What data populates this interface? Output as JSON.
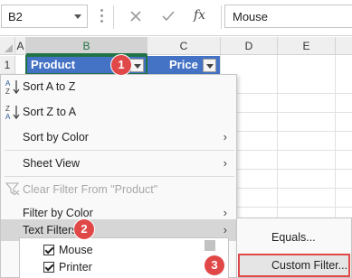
{
  "formula_bar": {
    "name_box": "B2",
    "fx": "fx",
    "content": "Mouse"
  },
  "columns": [
    "A",
    "B",
    "C",
    "D",
    "E"
  ],
  "rows": [
    "1"
  ],
  "header_row": {
    "product": "Product",
    "price": "Price"
  },
  "menu": {
    "sort_az": "Sort A to Z",
    "sort_za": "Sort Z to A",
    "sort_by_color": "Sort by Color",
    "sheet_view": "Sheet View",
    "clear_filter": "Clear Filter From \"Product\"",
    "filter_by_color": "Filter by Color",
    "text_filters": "Text Filters",
    "items": [
      {
        "label": "Mouse",
        "checked": true
      },
      {
        "label": "Printer",
        "checked": true
      }
    ]
  },
  "submenu": {
    "equals": "Equals...",
    "custom_filter": "Custom Filter..."
  },
  "badges": [
    "1",
    "2",
    "3"
  ],
  "colors": {
    "accent": "#217346",
    "header_fill": "#4472c4",
    "badge": "#e04848"
  }
}
